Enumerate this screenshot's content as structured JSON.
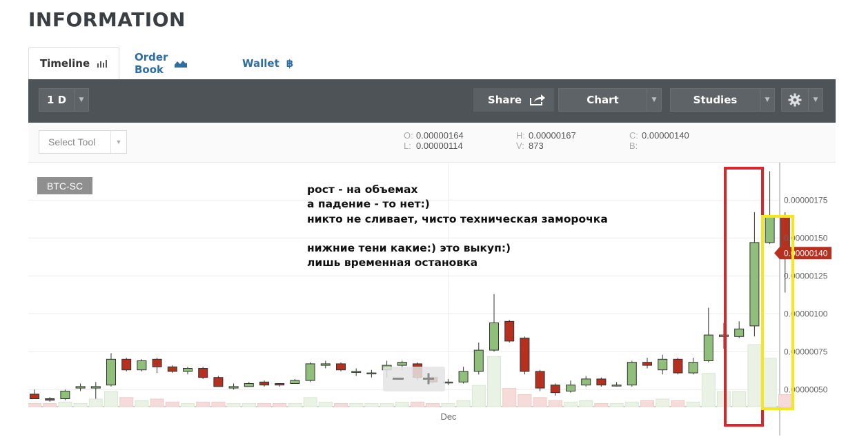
{
  "page": {
    "title": "INFORMATION"
  },
  "tabs": [
    {
      "label": "Timeline",
      "icon": "bar-chart-icon",
      "active": true
    },
    {
      "label": "Order Book",
      "icon": "area-chart-icon",
      "active": false
    },
    {
      "label": "Wallet",
      "icon": "bitcoin-icon",
      "active": false
    }
  ],
  "toolbar": {
    "interval": "1 D",
    "share": "Share",
    "chart": "Chart",
    "studies": "Studies",
    "settings_icon": "gear-icon"
  },
  "subbar": {
    "select_tool": "Select Tool",
    "ohlc": {
      "o_label": "O:",
      "o": "0.00000164",
      "l_label": "L:",
      "l": "0.00000114",
      "h_label": "H:",
      "h": "0.00000167",
      "v_label": "V:",
      "v": "873",
      "c_label": "C:",
      "c": "0.00000140",
      "b_label": "B:",
      "b": ""
    }
  },
  "chart": {
    "symbol": "BTC-SC",
    "x_tick": "Dec",
    "annotation": "рост - на объемах\nа падение - то нет:)\nникто не сливает, чисто техническая заморочка\n\nнижние тени какие:) это выкуп:)\nлишь временная остановка",
    "colors": {
      "up": "#8fbf7a",
      "down": "#b5301e",
      "price_tag": "#b5301e",
      "red_box": "#d9252c",
      "yellow_box": "#f5e61e"
    }
  },
  "chart_data": {
    "type": "candlestick",
    "y_ticks": [
      "0.00000175",
      "0.00000150",
      "0.00000125",
      "0.00000100",
      "0.00000075",
      "0.00000050"
    ],
    "y_tick_values": [
      1.75,
      1.5,
      1.25,
      1.0,
      0.75,
      0.5
    ],
    "y_unit_scale": "1e-6",
    "ylim": [
      0.4,
      2.0
    ],
    "last_price": "0.00000140",
    "last_price_value": 1.4,
    "candles": [
      {
        "o": 0.47,
        "c": 0.44,
        "h": 0.5,
        "l": 0.44,
        "v": 2
      },
      {
        "o": 0.44,
        "c": 0.43,
        "h": 0.45,
        "l": 0.42,
        "v": 2
      },
      {
        "o": 0.44,
        "c": 0.49,
        "h": 0.5,
        "l": 0.43,
        "v": 3
      },
      {
        "o": 0.51,
        "c": 0.52,
        "h": 0.54,
        "l": 0.49,
        "v": 2
      },
      {
        "o": 0.51,
        "c": 0.52,
        "h": 0.55,
        "l": 0.44,
        "v": 5
      },
      {
        "o": 0.53,
        "c": 0.7,
        "h": 0.74,
        "l": 0.52,
        "v": 10
      },
      {
        "o": 0.7,
        "c": 0.63,
        "h": 0.71,
        "l": 0.62,
        "v": 6
      },
      {
        "o": 0.63,
        "c": 0.69,
        "h": 0.7,
        "l": 0.62,
        "v": 4
      },
      {
        "o": 0.7,
        "c": 0.65,
        "h": 0.71,
        "l": 0.61,
        "v": 5
      },
      {
        "o": 0.65,
        "c": 0.62,
        "h": 0.66,
        "l": 0.61,
        "v": 3
      },
      {
        "o": 0.62,
        "c": 0.64,
        "h": 0.65,
        "l": 0.6,
        "v": 2
      },
      {
        "o": 0.64,
        "c": 0.58,
        "h": 0.65,
        "l": 0.57,
        "v": 3
      },
      {
        "o": 0.58,
        "c": 0.52,
        "h": 0.59,
        "l": 0.52,
        "v": 3
      },
      {
        "o": 0.51,
        "c": 0.52,
        "h": 0.54,
        "l": 0.5,
        "v": 2
      },
      {
        "o": 0.52,
        "c": 0.54,
        "h": 0.55,
        "l": 0.52,
        "v": 2
      },
      {
        "o": 0.55,
        "c": 0.53,
        "h": 0.56,
        "l": 0.52,
        "v": 2
      },
      {
        "o": 0.54,
        "c": 0.53,
        "h": 0.54,
        "l": 0.52,
        "v": 2
      },
      {
        "o": 0.54,
        "c": 0.56,
        "h": 0.57,
        "l": 0.54,
        "v": 2
      },
      {
        "o": 0.56,
        "c": 0.67,
        "h": 0.68,
        "l": 0.55,
        "v": 6
      },
      {
        "o": 0.66,
        "c": 0.67,
        "h": 0.69,
        "l": 0.64,
        "v": 3
      },
      {
        "o": 0.67,
        "c": 0.63,
        "h": 0.68,
        "l": 0.62,
        "v": 2
      },
      {
        "o": 0.62,
        "c": 0.62,
        "h": 0.64,
        "l": 0.59,
        "v": 2
      },
      {
        "o": 0.61,
        "c": 0.61,
        "h": 0.63,
        "l": 0.58,
        "v": 2
      },
      {
        "o": 0.63,
        "c": 0.66,
        "h": 0.69,
        "l": 0.58,
        "v": 2
      },
      {
        "o": 0.66,
        "c": 0.68,
        "h": 0.69,
        "l": 0.63,
        "v": 3
      },
      {
        "o": 0.67,
        "c": 0.58,
        "h": 0.68,
        "l": 0.56,
        "v": 3
      },
      {
        "o": 0.58,
        "c": 0.55,
        "h": 0.59,
        "l": 0.54,
        "v": 2
      },
      {
        "o": 0.55,
        "c": 0.55,
        "h": 0.57,
        "l": 0.53,
        "v": 2
      },
      {
        "o": 0.55,
        "c": 0.62,
        "h": 0.65,
        "l": 0.54,
        "v": 4
      },
      {
        "o": 0.62,
        "c": 0.76,
        "h": 0.81,
        "l": 0.6,
        "v": 14
      },
      {
        "o": 0.76,
        "c": 0.94,
        "h": 1.13,
        "l": 0.75,
        "v": 33
      },
      {
        "o": 0.95,
        "c": 0.82,
        "h": 0.96,
        "l": 0.81,
        "v": 12
      },
      {
        "o": 0.84,
        "c": 0.62,
        "h": 0.85,
        "l": 0.6,
        "v": 8
      },
      {
        "o": 0.62,
        "c": 0.51,
        "h": 0.63,
        "l": 0.49,
        "v": 6
      },
      {
        "o": 0.53,
        "c": 0.48,
        "h": 0.54,
        "l": 0.46,
        "v": 4
      },
      {
        "o": 0.49,
        "c": 0.53,
        "h": 0.56,
        "l": 0.48,
        "v": 3
      },
      {
        "o": 0.53,
        "c": 0.57,
        "h": 0.59,
        "l": 0.52,
        "v": 4
      },
      {
        "o": 0.57,
        "c": 0.53,
        "h": 0.58,
        "l": 0.52,
        "v": 2
      },
      {
        "o": 0.53,
        "c": 0.53,
        "h": 0.55,
        "l": 0.52,
        "v": 2
      },
      {
        "o": 0.53,
        "c": 0.68,
        "h": 0.69,
        "l": 0.52,
        "v": 3
      },
      {
        "o": 0.68,
        "c": 0.66,
        "h": 0.71,
        "l": 0.64,
        "v": 4
      },
      {
        "o": 0.63,
        "c": 0.7,
        "h": 0.73,
        "l": 0.6,
        "v": 5
      },
      {
        "o": 0.7,
        "c": 0.61,
        "h": 0.71,
        "l": 0.6,
        "v": 4
      },
      {
        "o": 0.61,
        "c": 0.68,
        "h": 0.71,
        "l": 0.6,
        "v": 3
      },
      {
        "o": 0.69,
        "c": 0.86,
        "h": 1.04,
        "l": 0.68,
        "v": 22
      },
      {
        "o": 0.85,
        "c": 0.86,
        "h": 0.94,
        "l": 0.77,
        "v": 10
      },
      {
        "o": 0.85,
        "c": 0.9,
        "h": 0.95,
        "l": 0.84,
        "v": 10
      },
      {
        "o": 0.92,
        "c": 1.47,
        "h": 1.67,
        "l": 0.85,
        "v": 41
      },
      {
        "o": 1.47,
        "c": 1.64,
        "h": 1.94,
        "l": 1.46,
        "v": 32
      },
      {
        "o": 1.64,
        "c": 1.4,
        "h": 1.67,
        "l": 1.14,
        "v": 8
      }
    ]
  }
}
